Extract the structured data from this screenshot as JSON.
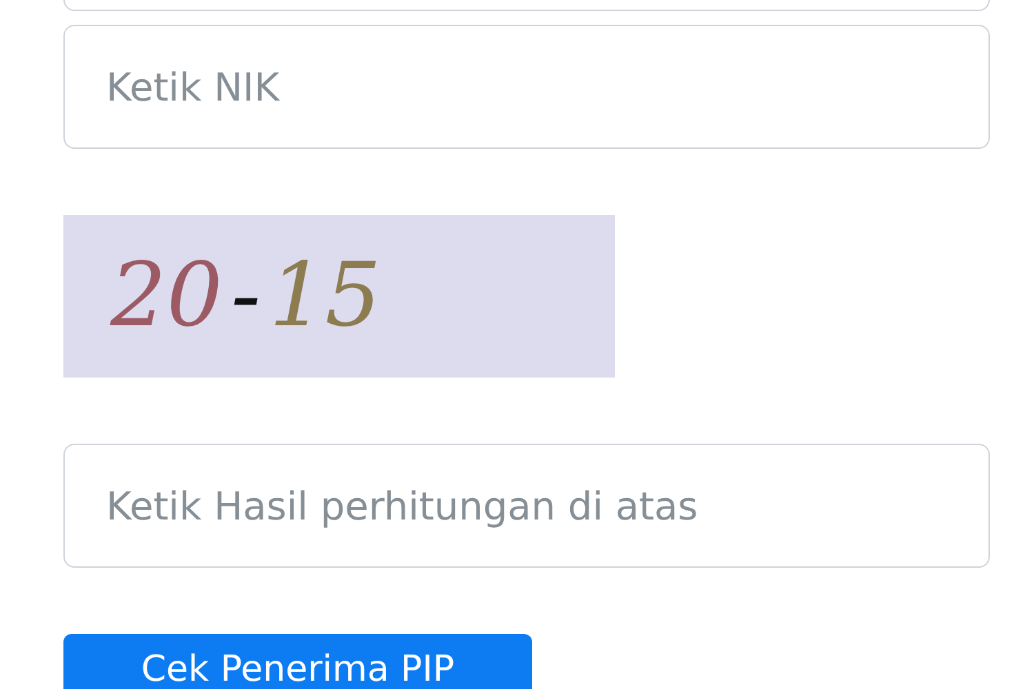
{
  "nik_field": {
    "placeholder": "Ketik NIK"
  },
  "captcha": {
    "parts": [
      {
        "text": "20",
        "color": "#9b5a64"
      },
      {
        "text": "-",
        "color": "#111111"
      },
      {
        "text": "15",
        "color": "#8c7c50"
      }
    ]
  },
  "answer_field": {
    "placeholder": "Ketik Hasil perhitungan di atas"
  },
  "submit_button": {
    "label": "Cek Penerima PIP"
  }
}
